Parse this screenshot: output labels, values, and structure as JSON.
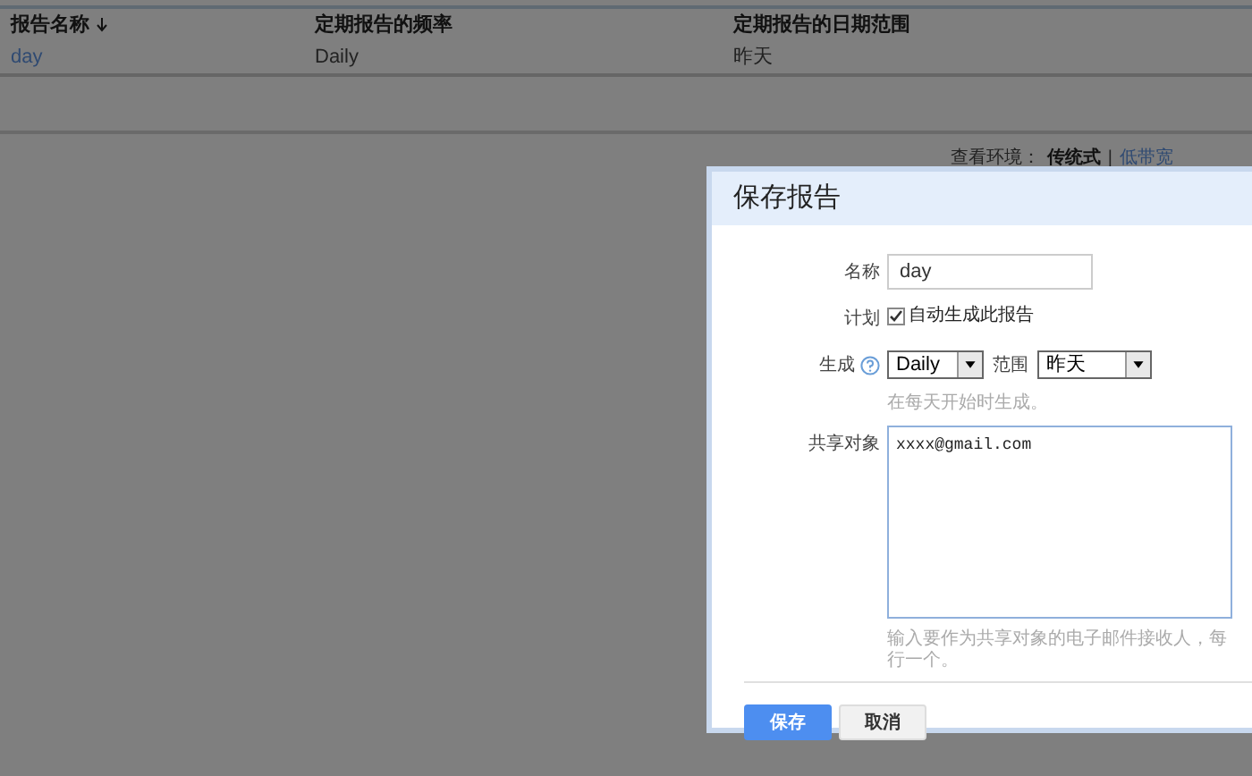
{
  "table": {
    "columns": [
      {
        "label": "报告名称",
        "sorted": true
      },
      {
        "label": "定期报告的频率",
        "sorted": false
      },
      {
        "label": "定期报告的日期范围",
        "sorted": false
      }
    ],
    "rows": [
      [
        "day",
        "Daily",
        "昨天"
      ]
    ]
  },
  "view_switch": {
    "label": "查看环境：",
    "current": "传统式",
    "separator": "|",
    "link": "低带宽"
  },
  "dialog": {
    "title": "保存报告",
    "name": {
      "label": "名称",
      "value": "day"
    },
    "schedule": {
      "label": "计划",
      "checkbox": "自动生成此报告",
      "checked": true
    },
    "generate": {
      "label": "生成",
      "frequency": "Daily",
      "range_label": "范围",
      "range": "昨天",
      "hint": "在每天开始时生成。"
    },
    "share": {
      "label": "共享对象",
      "value": "xxxx@gmail.com",
      "hint": "输入要作为共享对象的电子邮件接收人，每行一个。"
    },
    "buttons": [
      {
        "label": "保存",
        "kind": "primary"
      },
      {
        "label": "取消",
        "kind": "secondary"
      }
    ]
  }
}
